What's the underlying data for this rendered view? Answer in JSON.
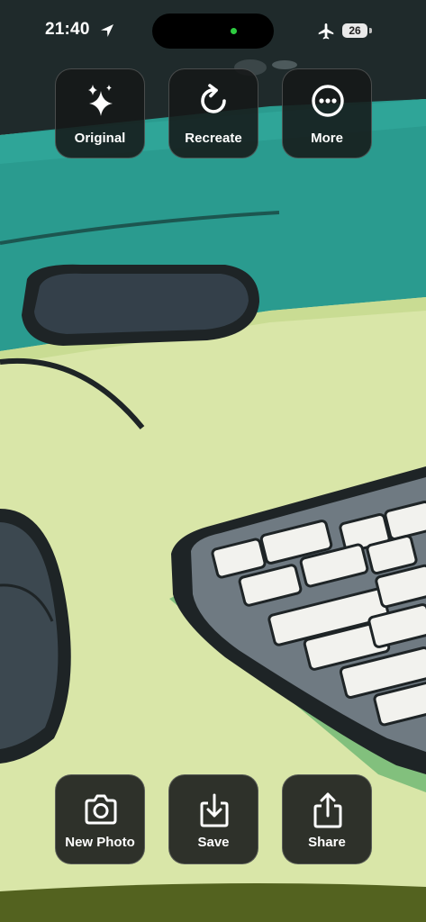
{
  "status_bar": {
    "time": "21:40",
    "battery_level": "26",
    "icons": [
      "location-arrow-icon",
      "airplane-mode-icon",
      "battery-icon"
    ],
    "camera_indicator_color": "#2ecc40"
  },
  "top_actions": {
    "original_label": "Original",
    "recreate_label": "Recreate",
    "more_label": "More"
  },
  "bottom_actions": {
    "new_photo_label": "New Photo",
    "save_label": "Save",
    "share_label": "Share"
  },
  "image": {
    "subject": "illustrated desk with keyboard and mouse",
    "palette": {
      "wall": "#2a9b8f",
      "desk": "#d9e6a8",
      "dark": "#1e2426"
    }
  }
}
